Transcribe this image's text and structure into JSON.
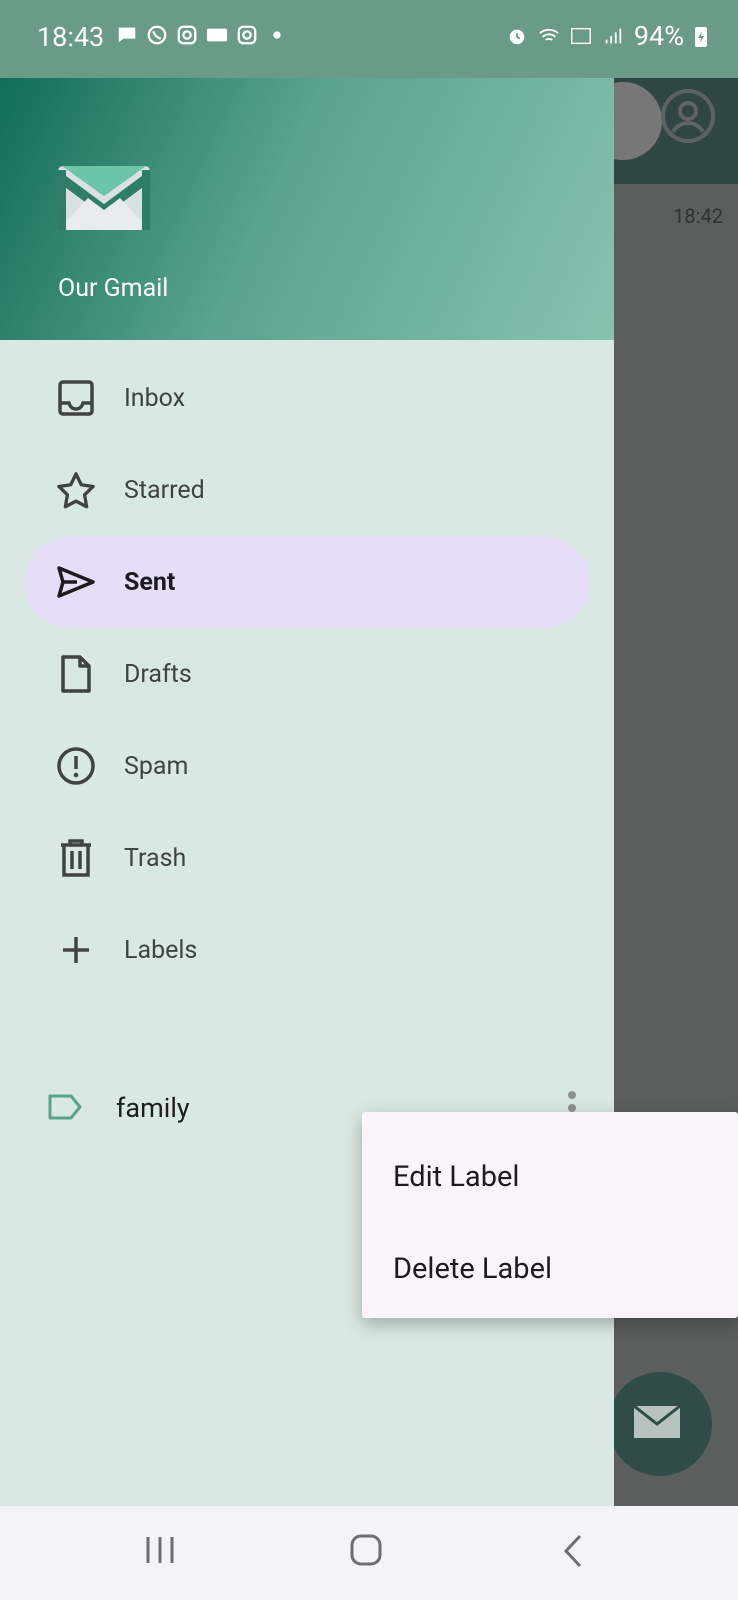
{
  "status_bar": {
    "time": "18:43",
    "battery": "94%",
    "notification_icons": [
      "chat-bubble-icon",
      "whatsapp-icon",
      "instagram-icon",
      "news-app-icon",
      "instagram-icon",
      "dot-icon"
    ],
    "right_icons": [
      "alarm-icon",
      "wifi-icon",
      "volte-icon",
      "signal-icon",
      "battery-charging-icon"
    ]
  },
  "drawer": {
    "app_name": "Our Gmail",
    "items": [
      {
        "label": "Inbox",
        "icon": "inbox-icon"
      },
      {
        "label": "Starred",
        "icon": "star-icon"
      },
      {
        "label": "Sent",
        "icon": "send-icon",
        "active": true
      },
      {
        "label": "Drafts",
        "icon": "draft-icon"
      },
      {
        "label": "Spam",
        "icon": "alert-circle-icon"
      },
      {
        "label": "Trash",
        "icon": "trash-icon"
      },
      {
        "label": "Labels",
        "icon": "plus-icon"
      }
    ],
    "user_labels": [
      {
        "label": "family",
        "icon": "label-tag-icon"
      }
    ]
  },
  "popup_menu": {
    "items": [
      "Edit Label",
      "Delete Label"
    ]
  },
  "background": {
    "email_time": "18:42"
  },
  "colors": {
    "header_start": "#0f6b57",
    "header_end": "#86c3b0",
    "drawer_bg": "#dae8e3",
    "active_bg": "#e6def6",
    "tag_icon": "#5aa38e"
  }
}
